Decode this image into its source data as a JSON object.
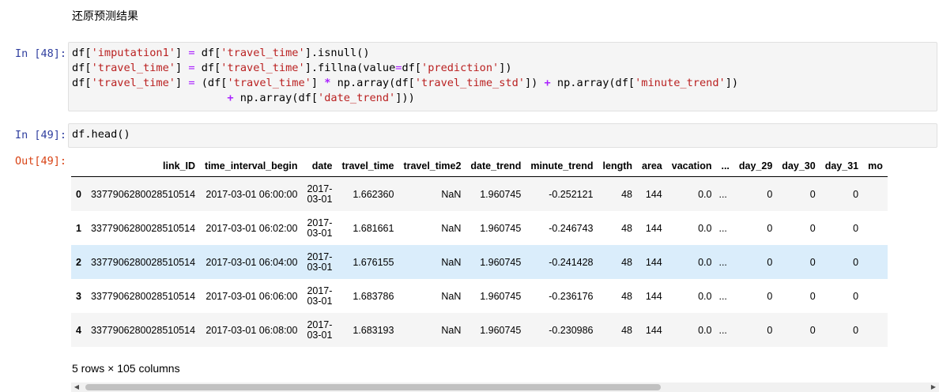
{
  "markdown_cell": {
    "text": "还原预测结果"
  },
  "cell48": {
    "prompt": "In [48]:",
    "lines": [
      [
        [
          "v",
          "df["
        ],
        [
          "s",
          "'imputation1'"
        ],
        [
          "v",
          "] "
        ],
        [
          "e",
          "="
        ],
        [
          "v",
          " df["
        ],
        [
          "s",
          "'travel_time'"
        ],
        [
          "v",
          "].isnull()"
        ]
      ],
      [
        [
          "v",
          "df["
        ],
        [
          "s",
          "'travel_time'"
        ],
        [
          "v",
          "] "
        ],
        [
          "e",
          "="
        ],
        [
          "v",
          " df["
        ],
        [
          "s",
          "'travel_time'"
        ],
        [
          "v",
          "].fillna(value"
        ],
        [
          "e",
          "="
        ],
        [
          "v",
          "df["
        ],
        [
          "s",
          "'prediction'"
        ],
        [
          "v",
          "])"
        ]
      ],
      [
        [
          "v",
          "df["
        ],
        [
          "s",
          "'travel_time'"
        ],
        [
          "v",
          "] "
        ],
        [
          "e",
          "="
        ],
        [
          "v",
          " (df["
        ],
        [
          "s",
          "'travel_time'"
        ],
        [
          "v",
          "] "
        ],
        [
          "o",
          "*"
        ],
        [
          "v",
          " np.array(df["
        ],
        [
          "s",
          "'travel_time_std'"
        ],
        [
          "v",
          "]) "
        ],
        [
          "o",
          "+"
        ],
        [
          "v",
          " np.array(df["
        ],
        [
          "s",
          "'minute_trend'"
        ],
        [
          "v",
          "])"
        ]
      ],
      [
        [
          "v",
          "                        "
        ],
        [
          "o",
          "+"
        ],
        [
          "v",
          " np.array(df["
        ],
        [
          "s",
          "'date_trend'"
        ],
        [
          "v",
          "]))"
        ]
      ]
    ]
  },
  "cell49": {
    "prompt": "In [49]:",
    "code": "df.head()",
    "out_prompt": "Out[49]:",
    "table": {
      "columns": [
        "",
        "link_ID",
        "time_interval_begin",
        "date",
        "travel_time",
        "travel_time2",
        "date_trend",
        "minute_trend",
        "length",
        "area",
        "vacation",
        "...",
        "day_29",
        "day_30",
        "day_31",
        "mo"
      ],
      "rows": [
        [
          "0",
          "3377906280028510514",
          "2017-03-01 06:00:00",
          "2017-03-01",
          "1.662360",
          "NaN",
          "1.960745",
          "-0.252121",
          "48",
          "144",
          "0.0",
          "...",
          "0",
          "0",
          "0",
          ""
        ],
        [
          "1",
          "3377906280028510514",
          "2017-03-01 06:02:00",
          "2017-03-01",
          "1.681661",
          "NaN",
          "1.960745",
          "-0.246743",
          "48",
          "144",
          "0.0",
          "...",
          "0",
          "0",
          "0",
          ""
        ],
        [
          "2",
          "3377906280028510514",
          "2017-03-01 06:04:00",
          "2017-03-01",
          "1.676155",
          "NaN",
          "1.960745",
          "-0.241428",
          "48",
          "144",
          "0.0",
          "...",
          "0",
          "0",
          "0",
          ""
        ],
        [
          "3",
          "3377906280028510514",
          "2017-03-01 06:06:00",
          "2017-03-01",
          "1.683786",
          "NaN",
          "1.960745",
          "-0.236176",
          "48",
          "144",
          "0.0",
          "...",
          "0",
          "0",
          "0",
          ""
        ],
        [
          "4",
          "3377906280028510514",
          "2017-03-01 06:08:00",
          "2017-03-01",
          "1.683193",
          "NaN",
          "1.960745",
          "-0.230986",
          "48",
          "144",
          "0.0",
          "...",
          "0",
          "0",
          "0",
          ""
        ]
      ],
      "hover_row": 2
    },
    "summary": "5 rows × 105 columns"
  },
  "scrollbar": {
    "left_arrow": "◀",
    "right_arrow": "▶"
  }
}
